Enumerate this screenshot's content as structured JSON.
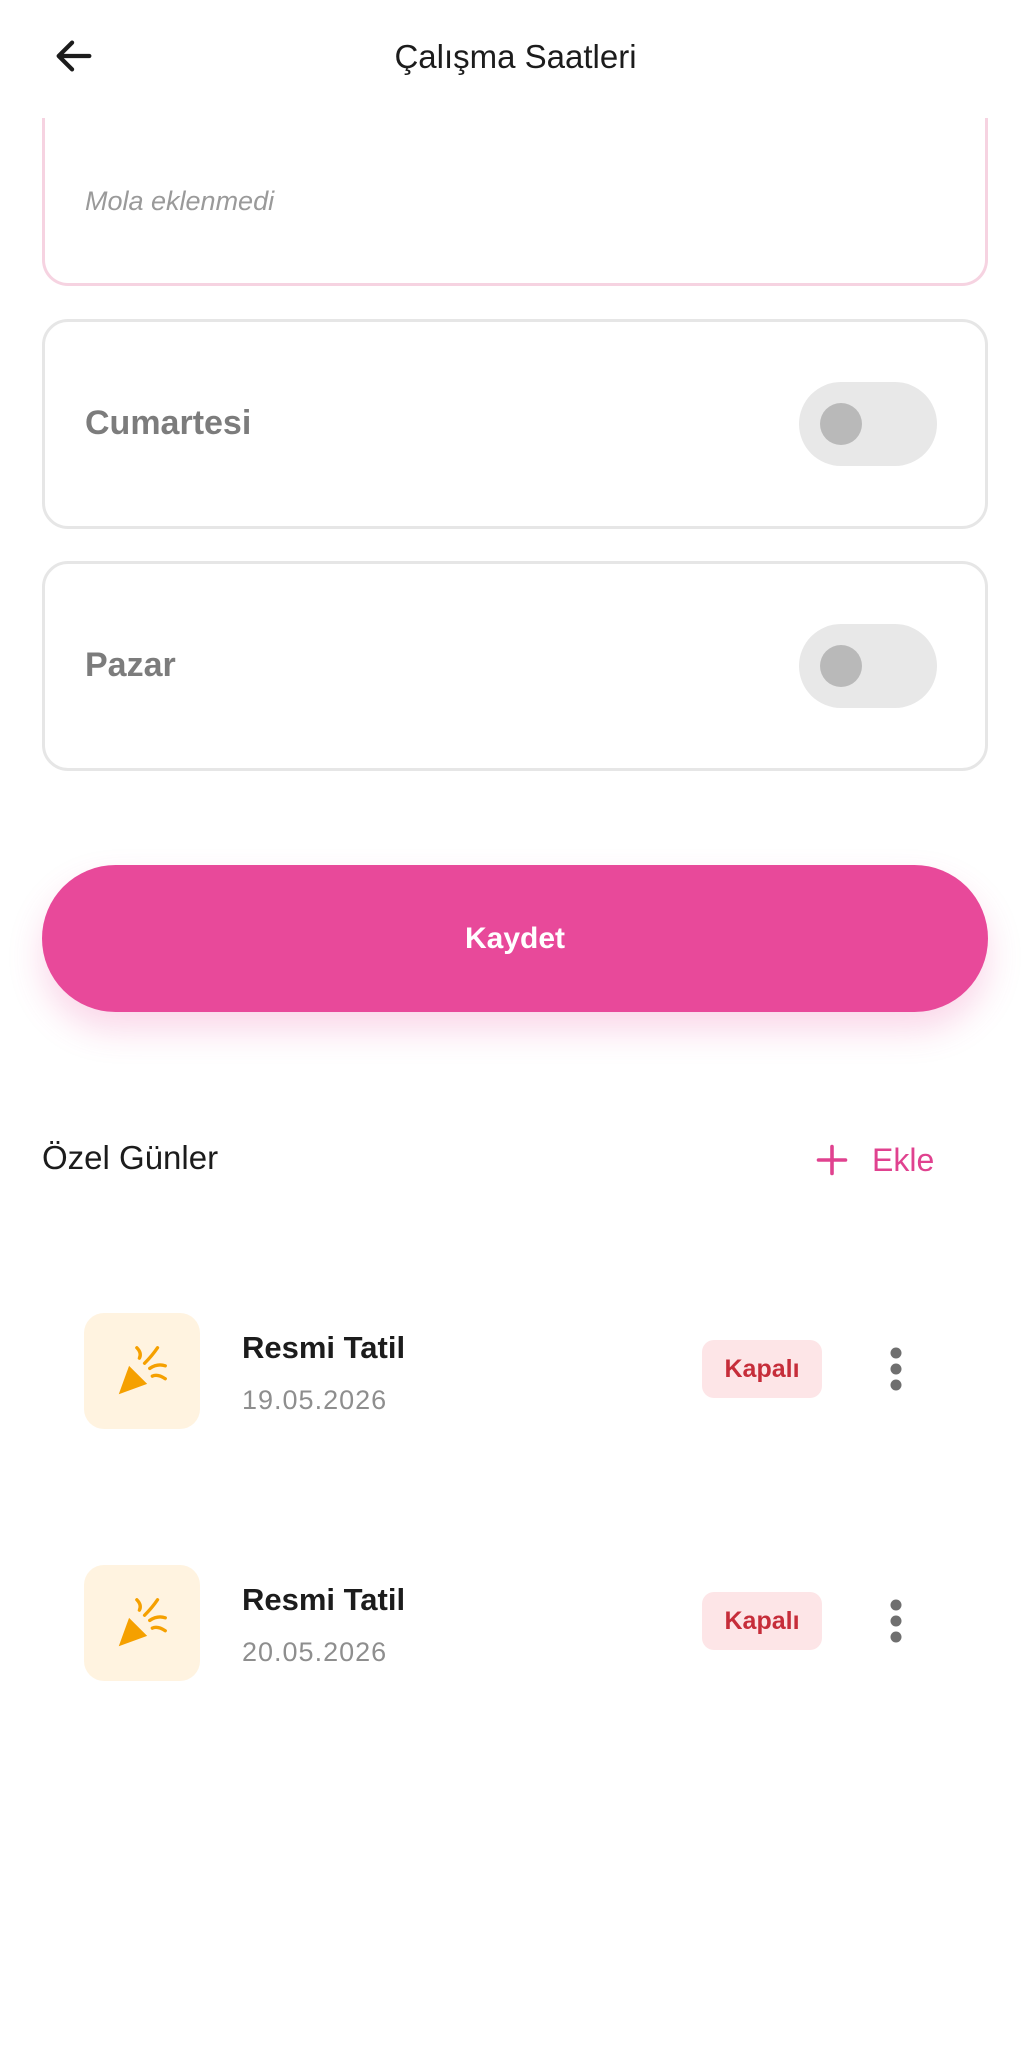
{
  "header": {
    "title": "Çalışma Saatleri",
    "back_icon": "arrow-left-icon"
  },
  "break_card": {
    "empty_text": "Mola eklenmedi"
  },
  "days": [
    {
      "label": "Cumartesi",
      "enabled": false
    },
    {
      "label": "Pazar",
      "enabled": false
    }
  ],
  "save_button": {
    "label": "Kaydet",
    "color": "#e8499a"
  },
  "special_days": {
    "title": "Özel Günler",
    "add_label": "Ekle",
    "add_icon": "plus-icon",
    "items": [
      {
        "title": "Resmi Tatil",
        "date": "19.05.2026",
        "status": "Kapalı",
        "icon": "party-popper-icon"
      },
      {
        "title": "Resmi Tatil",
        "date": "20.05.2026",
        "status": "Kapalı",
        "icon": "party-popper-icon"
      }
    ]
  },
  "colors": {
    "accent": "#e8499a",
    "status_closed_bg": "#fde5e7",
    "status_closed_text": "#c62d3a",
    "icon_orange": "#f5a000"
  }
}
